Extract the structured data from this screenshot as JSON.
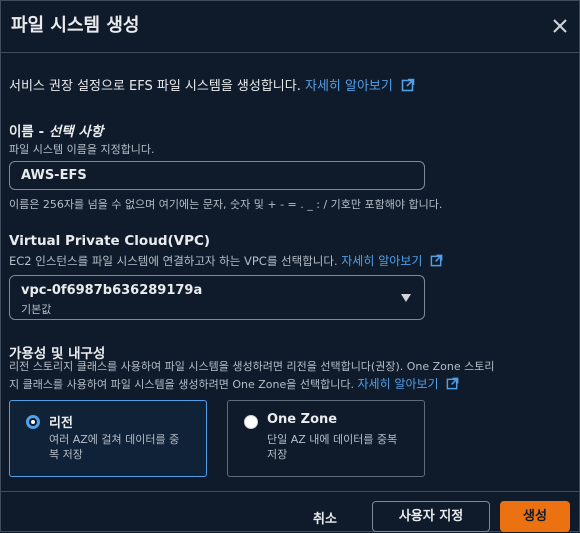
{
  "title": "파일 시스템 생성",
  "intro": {
    "text": "서비스 권장 설정으로 EFS 파일 시스템을 생성합니다.",
    "link": "자세히 알아보기"
  },
  "name_field": {
    "label": "이름",
    "label_optional": "선택 사항",
    "description": "파일 시스템 이름을 지정합니다.",
    "value": "AWS-EFS",
    "constraint": "이름은 256자를 넘을 수 없으며 여기에는 문자, 숫자 및 + - = . _ : / 기호만 포함해야 합니다."
  },
  "vpc_field": {
    "label": "Virtual Private Cloud(VPC)",
    "description": "EC2 인스턴스를 파일 시스템에 연결하고자 하는 VPC를 선택합니다.",
    "link": "자세히 알아보기",
    "selected_value": "vpc-0f6987b636289179a",
    "selected_sub": "기본값"
  },
  "availability": {
    "label": "가용성 및 내구성",
    "description_line1": "리전 스토리지 클래스를 사용하여 파일 시스템을 생성하려면 리전을 선택합니다(권장). One Zone 스토리",
    "description_line2": "지 클래스를 사용하여 파일 시스템을 생성하려면 One Zone을 선택합니다.",
    "link": "자세히 알아보기",
    "options": [
      {
        "title": "리전",
        "desc": "여러 AZ에 걸쳐 데이터를 중복 저장",
        "selected": true
      },
      {
        "title": "One Zone",
        "desc": "단일 AZ 내에 데이터를 중복 저장",
        "selected": false
      }
    ]
  },
  "footer": {
    "cancel": "취소",
    "customize": "사용자 지정",
    "create": "생성"
  },
  "colors": {
    "background": "#0f1b2a",
    "link": "#539fe5",
    "primary": "#ec7211"
  },
  "icons": {
    "close": "close-icon",
    "external": "external-link-icon",
    "dropdown": "caret-down-icon"
  }
}
